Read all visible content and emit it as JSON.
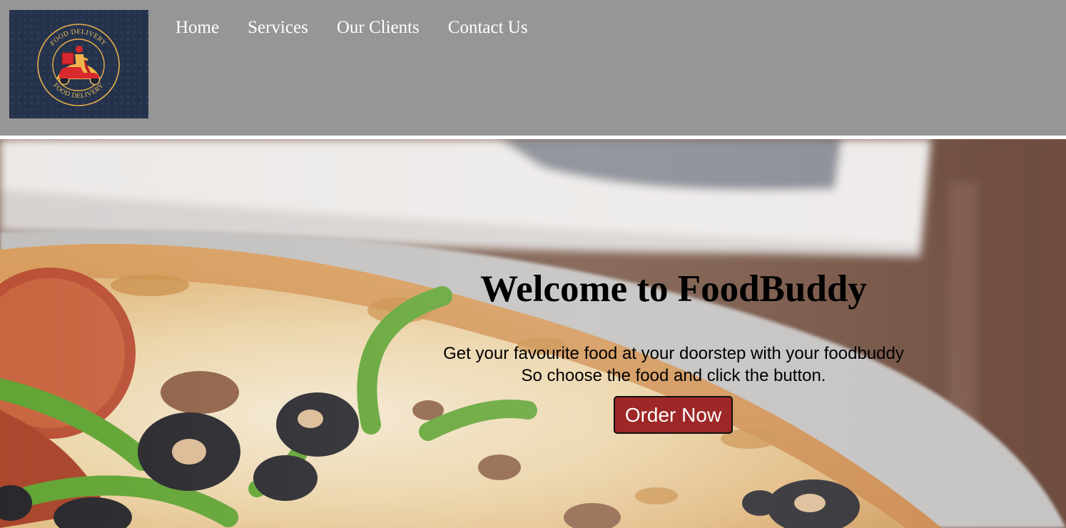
{
  "logo": {
    "text_top": "FOOD DELIVERY",
    "text_bottom": "FOOD DELIVERY"
  },
  "nav": {
    "items": [
      {
        "label": "Home"
      },
      {
        "label": "Services"
      },
      {
        "label": "Our Clients"
      },
      {
        "label": "Contact Us"
      }
    ]
  },
  "hero": {
    "title": "Welcome to FoodBuddy",
    "line1": "Get your favourite food at your doorstep with your foodbuddy",
    "line2": "So choose the food and click the button.",
    "button_label": "Order Now"
  },
  "colors": {
    "header_bg": "#969696",
    "button_bg": "#9e2727",
    "logo_bg": "#25324b",
    "logo_accent": "#e8b04a"
  }
}
